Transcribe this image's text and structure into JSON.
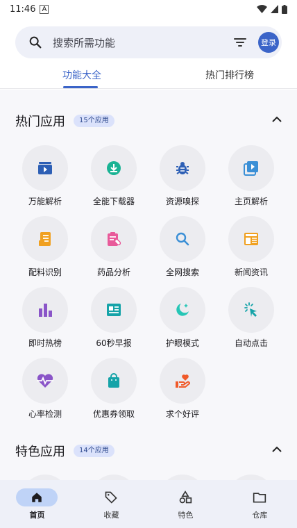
{
  "status": {
    "time": "11:46",
    "sim_glyph": "A"
  },
  "search": {
    "placeholder": "搜索所需功能",
    "login_label": "登录"
  },
  "tabs": [
    {
      "label": "功能大全",
      "active": true
    },
    {
      "label": "热门排行榜",
      "active": false
    }
  ],
  "sections": [
    {
      "title": "热门应用",
      "badge": "15个应用",
      "items": [
        {
          "label": "万能解析",
          "icon": "video-folder-icon",
          "color": "#2d5fb5"
        },
        {
          "label": "全能下载器",
          "icon": "download-icon",
          "color": "#1ab394"
        },
        {
          "label": "资源嗅探",
          "icon": "bug-icon",
          "color": "#2d5fb5"
        },
        {
          "label": "主页解析",
          "icon": "video-library-icon",
          "color": "#3a8fd6"
        },
        {
          "label": "配料识别",
          "icon": "receipt-icon",
          "color": "#f0a020"
        },
        {
          "label": "药品分析",
          "icon": "medical-note-icon",
          "color": "#e85a9a"
        },
        {
          "label": "全网搜索",
          "icon": "search-icon",
          "color": "#3a8fd6"
        },
        {
          "label": "新闻资讯",
          "icon": "newspaper-icon",
          "color": "#f0a020"
        },
        {
          "label": "即时热榜",
          "icon": "bar-chart-icon",
          "color": "#8a55c8"
        },
        {
          "label": "60秒早报",
          "icon": "article-icon",
          "color": "#15a3a8"
        },
        {
          "label": "护眼模式",
          "icon": "night-mode-icon",
          "color": "#26c6b6"
        },
        {
          "label": "自动点击",
          "icon": "tap-icon",
          "color": "#15a3a8"
        },
        {
          "label": "心率检测",
          "icon": "heart-rate-icon",
          "color": "#8a55c8"
        },
        {
          "label": "优惠券领取",
          "icon": "shopping-bag-icon",
          "color": "#15a3a8"
        },
        {
          "label": "求个好评",
          "icon": "heart-hand-icon",
          "color": "#f05a2a"
        }
      ]
    },
    {
      "title": "特色应用",
      "badge": "14个应用"
    }
  ],
  "nav": [
    {
      "label": "首页",
      "icon": "home-icon",
      "active": true
    },
    {
      "label": "收藏",
      "icon": "tag-icon",
      "active": false
    },
    {
      "label": "特色",
      "icon": "shapes-icon",
      "active": false
    },
    {
      "label": "仓库",
      "icon": "folder-icon",
      "active": false
    }
  ]
}
